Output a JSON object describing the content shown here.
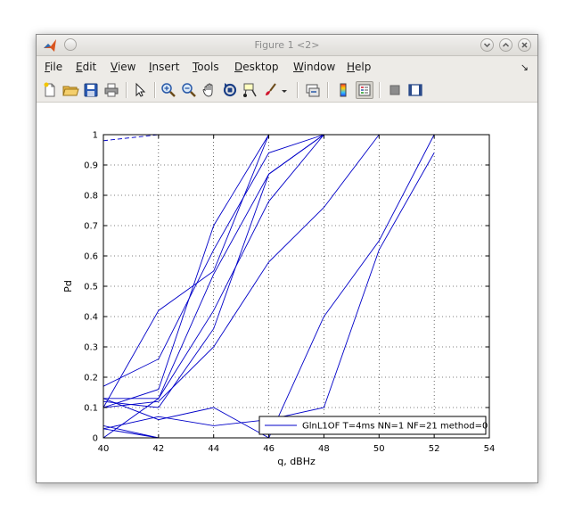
{
  "window": {
    "title": "Figure 1 <2>"
  },
  "menu": {
    "items": [
      {
        "label": "File",
        "accel": "F",
        "rest": "ile"
      },
      {
        "label": "Edit",
        "accel": "E",
        "rest": "dit"
      },
      {
        "label": "View",
        "accel": "V",
        "rest": "iew"
      },
      {
        "label": "Insert",
        "accel": "I",
        "rest": "nsert"
      },
      {
        "label": "Tools",
        "accel": "T",
        "rest": "ools"
      },
      {
        "label": "Desktop",
        "accel": "D",
        "rest": "esktop"
      },
      {
        "label": "Window",
        "accel": "W",
        "rest": "indow"
      },
      {
        "label": "Help",
        "accel": "H",
        "rest": "elp"
      }
    ],
    "overflow_arrow": "↘"
  },
  "toolbar": {
    "icons": [
      "new-figure-icon",
      "open-file-icon",
      "save-icon",
      "print-icon",
      "pointer-icon",
      "zoom-in-icon",
      "zoom-out-icon",
      "pan-icon",
      "rotate-icon",
      "data-cursor-icon",
      "brush-icon",
      "link-icon",
      "colorbar-icon",
      "legend-icon",
      "hide-plot-tools-icon",
      "show-plot-tools-icon"
    ]
  },
  "chart_data": {
    "type": "line",
    "xlabel": "q, dBHz",
    "ylabel": "Pd",
    "xlim": [
      40,
      54
    ],
    "ylim": [
      0,
      1
    ],
    "xticks": [
      40,
      42,
      44,
      46,
      48,
      50,
      52,
      54
    ],
    "yticks": [
      0,
      0.1,
      0.2,
      0.3,
      0.4,
      0.5,
      0.6,
      0.7,
      0.8,
      0.9,
      1
    ],
    "ytick_labels": [
      "0",
      "0.1",
      "0.2",
      "0.3",
      "0.4",
      "0.5",
      "0.6",
      "0.7",
      "0.8",
      "0.9",
      "1"
    ],
    "grid": true,
    "line_color": "#0000c8",
    "legend": {
      "placement": "bottom-right",
      "label": "GlnL1OF T=4ms NN=1 NF=21 method=0"
    },
    "series": [
      {
        "x": [
          40,
          42
        ],
        "y": [
          0.98,
          1.0
        ],
        "dashed": true
      },
      {
        "x": [
          40,
          42,
          44,
          46,
          48
        ],
        "y": [
          0.17,
          0.26,
          0.62,
          0.94,
          1.0
        ]
      },
      {
        "x": [
          40,
          42,
          44,
          46,
          48
        ],
        "y": [
          0.1,
          0.16,
          0.7,
          1.0,
          1.0
        ]
      },
      {
        "x": [
          40,
          42,
          44,
          46,
          48
        ],
        "y": [
          0.13,
          0.13,
          0.54,
          0.87,
          1.0
        ]
      },
      {
        "x": [
          40,
          42,
          44,
          46
        ],
        "y": [
          0.1,
          0.42,
          0.55,
          1.0
        ]
      },
      {
        "x": [
          40,
          42,
          44,
          46,
          48
        ],
        "y": [
          0.12,
          0.1,
          0.36,
          0.87,
          1.0
        ]
      },
      {
        "x": [
          40,
          42,
          44,
          46,
          48
        ],
        "y": [
          0.0,
          0.13,
          0.42,
          0.78,
          1.0
        ]
      },
      {
        "x": [
          40,
          42,
          44,
          46,
          48,
          50
        ],
        "y": [
          0.1,
          0.12,
          0.3,
          0.58,
          0.76,
          1.0
        ]
      },
      {
        "x": [
          40,
          42,
          44,
          46,
          48,
          50,
          52
        ],
        "y": [
          0.04,
          0.0,
          0.0,
          0.0,
          0.4,
          0.65,
          1.0
        ]
      },
      {
        "x": [
          40,
          42,
          44,
          46,
          48,
          50,
          52
        ],
        "y": [
          0.03,
          0.07,
          0.04,
          0.06,
          0.1,
          0.62,
          0.94
        ]
      },
      {
        "x": [
          40,
          42,
          44,
          46
        ],
        "y": [
          0.13,
          0.06,
          0.1,
          0.0
        ]
      },
      {
        "x": [
          40,
          42,
          44,
          46
        ],
        "y": [
          0.03,
          0.0,
          0.0,
          0.0
        ]
      }
    ]
  }
}
